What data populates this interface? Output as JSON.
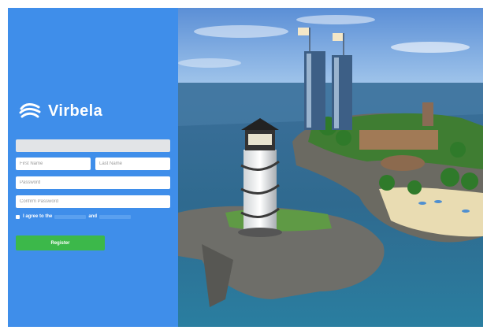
{
  "brand": {
    "name": "Virbela"
  },
  "form": {
    "top_field_placeholder": "",
    "first_name_placeholder": "First Name",
    "last_name_placeholder": "Last Name",
    "password_placeholder": "Password",
    "confirm_password_placeholder": "Confirm Password",
    "agree_prefix": "I agree to the",
    "agree_and": "and",
    "register_label": "Register"
  },
  "colors": {
    "panel_blue": "#3f8eea",
    "register_green": "#3cb84a"
  },
  "icons": [
    "virbela-logo-icon"
  ]
}
